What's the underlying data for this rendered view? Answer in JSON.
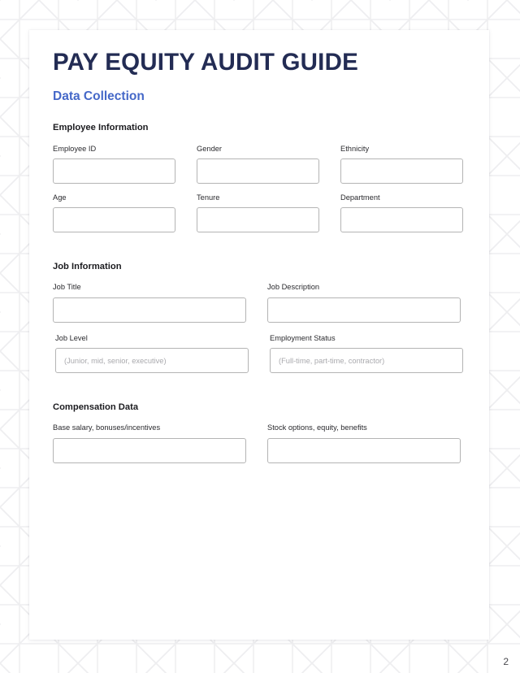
{
  "document": {
    "title": "PAY EQUITY AUDIT GUIDE",
    "subtitle": "Data Collection",
    "page_number": "2",
    "colors": {
      "title": "#232c54",
      "subtitle": "#4568c8",
      "section_heading": "#1b1b1f",
      "input_border": "#b4b4b4",
      "placeholder": "#a9a9ad",
      "card_background": "#ffffff",
      "page_background": "#ffffff",
      "pattern_line": "#eeeef0"
    }
  },
  "sections": [
    {
      "id": "employee",
      "heading": "Employee Information",
      "columns": 3,
      "fields": [
        {
          "label": "Employee ID",
          "value": "",
          "placeholder": ""
        },
        {
          "label": "Gender",
          "value": "",
          "placeholder": ""
        },
        {
          "label": "Ethnicity",
          "value": "",
          "placeholder": ""
        },
        {
          "label": "Age",
          "value": "",
          "placeholder": ""
        },
        {
          "label": "Tenure",
          "value": "",
          "placeholder": ""
        },
        {
          "label": "Department",
          "value": "",
          "placeholder": ""
        }
      ]
    },
    {
      "id": "job",
      "heading": "Job Information",
      "columns": 2,
      "fields": [
        {
          "label": "Job Title",
          "value": "",
          "placeholder": ""
        },
        {
          "label": "Job Description",
          "value": "",
          "placeholder": ""
        },
        {
          "label": "Job Level",
          "value": "",
          "placeholder": "(Junior, mid, senior, executive)"
        },
        {
          "label": "Employment Status",
          "value": "",
          "placeholder": "(Full-time, part-time, contractor)"
        }
      ]
    },
    {
      "id": "compensation",
      "heading": "Compensation Data",
      "columns": 2,
      "fields": [
        {
          "label": "Base salary, bonuses/incentives",
          "value": "",
          "placeholder": ""
        },
        {
          "label": "Stock options, equity, benefits",
          "value": "",
          "placeholder": ""
        }
      ]
    }
  ]
}
